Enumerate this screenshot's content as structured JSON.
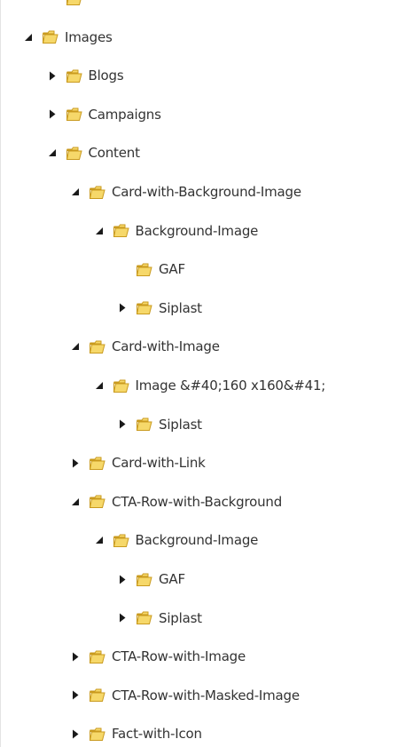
{
  "tree": {
    "nodes": [
      {
        "label": "",
        "depth": 2,
        "state": "none"
      },
      {
        "label": "Images",
        "depth": 1,
        "state": "expanded"
      },
      {
        "label": "Blogs",
        "depth": 2,
        "state": "collapsed"
      },
      {
        "label": "Campaigns",
        "depth": 2,
        "state": "collapsed"
      },
      {
        "label": "Content",
        "depth": 2,
        "state": "expanded"
      },
      {
        "label": "Card-with-Background-Image",
        "depth": 3,
        "state": "expanded"
      },
      {
        "label": "Background-Image",
        "depth": 4,
        "state": "expanded"
      },
      {
        "label": "GAF",
        "depth": 5,
        "state": "none"
      },
      {
        "label": "Siplast",
        "depth": 5,
        "state": "collapsed"
      },
      {
        "label": "Card-with-Image",
        "depth": 3,
        "state": "expanded"
      },
      {
        "label": "Image &#40;160 x160&#41;",
        "depth": 4,
        "state": "expanded"
      },
      {
        "label": "Siplast",
        "depth": 5,
        "state": "collapsed"
      },
      {
        "label": "Card-with-Link",
        "depth": 3,
        "state": "collapsed"
      },
      {
        "label": "CTA-Row-with-Background",
        "depth": 3,
        "state": "expanded"
      },
      {
        "label": "Background-Image",
        "depth": 4,
        "state": "expanded"
      },
      {
        "label": "GAF",
        "depth": 5,
        "state": "collapsed"
      },
      {
        "label": "Siplast",
        "depth": 5,
        "state": "collapsed"
      },
      {
        "label": "CTA-Row-with-Image",
        "depth": 3,
        "state": "collapsed"
      },
      {
        "label": "CTA-Row-with-Masked-Image",
        "depth": 3,
        "state": "collapsed"
      },
      {
        "label": "Fact-with-Icon",
        "depth": 3,
        "state": "collapsed"
      }
    ]
  },
  "colors": {
    "folder_fill": "#f6d86a",
    "folder_stroke": "#c99a1e",
    "arrow": "#1a1a1a",
    "text": "#333333"
  }
}
